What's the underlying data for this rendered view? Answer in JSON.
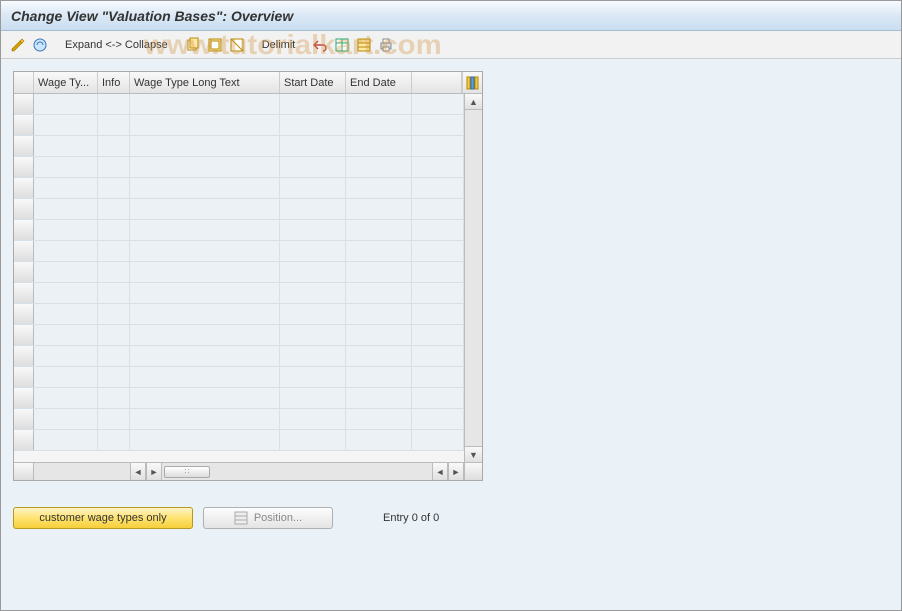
{
  "title": "Change View \"Valuation Bases\": Overview",
  "toolbar": {
    "expand_collapse": "Expand <-> Collapse",
    "delimit": "Delimit"
  },
  "grid": {
    "columns": {
      "wage_type": "Wage Ty...",
      "info": "Info",
      "long_text": "Wage Type Long Text",
      "start_date": "Start Date",
      "end_date": "End Date"
    },
    "row_count": 17
  },
  "buttons": {
    "customer_wage_types": "customer wage types only",
    "position": "Position..."
  },
  "status": {
    "entry_text": "Entry 0 of 0"
  },
  "watermark": "www.tutorialkart.com"
}
